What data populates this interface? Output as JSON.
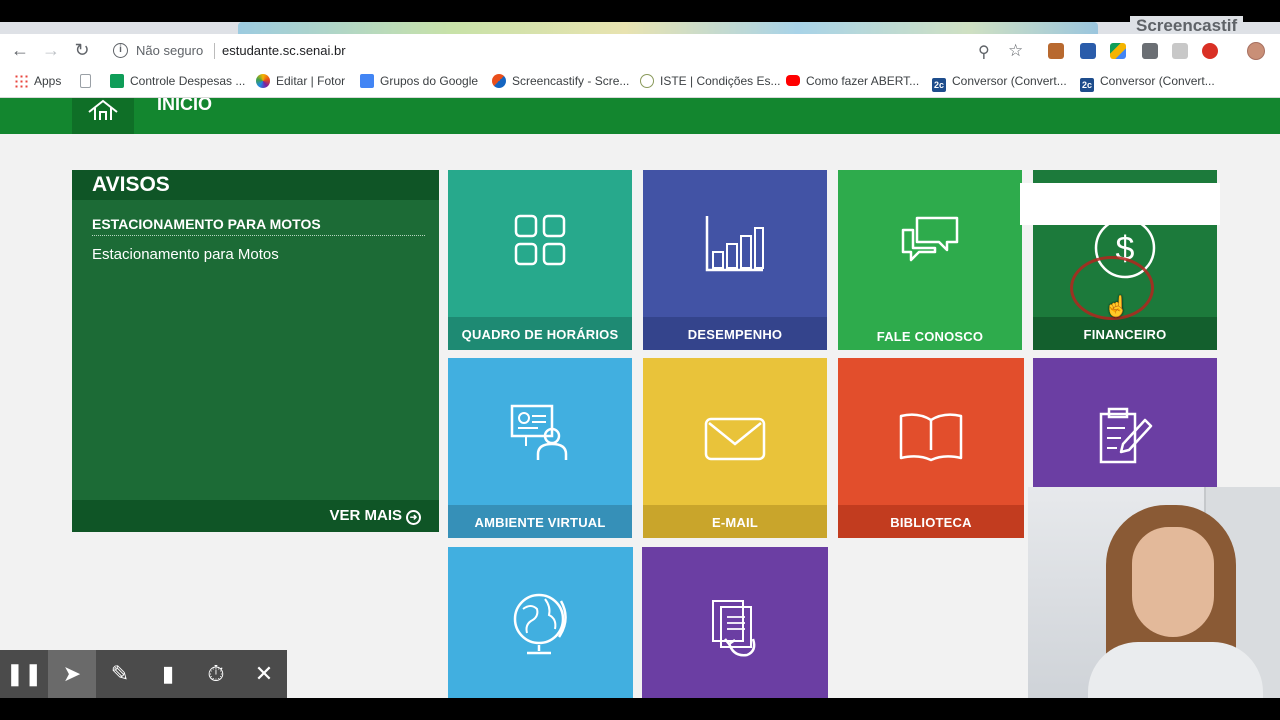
{
  "browser": {
    "brand_text": "Screencastif",
    "security_label": "Não seguro",
    "url": "estudante.sc.senai.br",
    "bookmarks": [
      {
        "label": "Apps",
        "icon": "apps-grid-icon",
        "color": "#e8453c"
      },
      {
        "label": "",
        "icon": "page-icon",
        "color": "#9aa0a6"
      },
      {
        "label": "Controle Despesas ...",
        "icon": "sheets-icon",
        "color": "#0f9d58"
      },
      {
        "label": "Editar | Fotor",
        "icon": "fotor-icon",
        "color": "#f4b400"
      },
      {
        "label": "Grupos do Google",
        "icon": "groups-icon",
        "color": "#4285f4"
      },
      {
        "label": "Screencastify - Scre...",
        "icon": "screencastify-icon",
        "color": "#e94e1b"
      },
      {
        "label": "ISTE | Condições Es...",
        "icon": "iste-icon",
        "color": "#8a9a5b"
      },
      {
        "label": "Como fazer ABERT...",
        "icon": "youtube-icon",
        "color": "#ff0000"
      },
      {
        "label": "Conversor (Convert...",
        "icon": "converter-icon",
        "color": "#1e4d8c"
      },
      {
        "label": "Conversor (Convert...",
        "icon": "converter-icon",
        "color": "#1e4d8c"
      }
    ]
  },
  "page": {
    "section_title": "INICIO",
    "avisos": {
      "title": "AVISOS",
      "notice_title": "ESTACIONAMENTO PARA MOTOS",
      "notice_body": "Estacionamento para Motos",
      "more_label": "VER MAIS"
    },
    "tiles": [
      {
        "label": "QUADRO DE HORÁRIOS",
        "icon": "grid-icon",
        "color": "#27a98c",
        "bar": "#1e8a73"
      },
      {
        "label": "DESEMPENHO",
        "icon": "bar-chart-icon",
        "color": "#4253a5",
        "bar": "#34448c"
      },
      {
        "label": "FALE CONOSCO",
        "icon": "chat-bubbles-icon",
        "color": "#2eab4c",
        "bar": "#2eab4c"
      },
      {
        "label": "FINANCEIRO",
        "icon": "dollar-icon",
        "color": "#1c7a3b",
        "bar": "#135f2d"
      },
      {
        "label": "AMBIENTE VIRTUAL",
        "icon": "virtual-class-icon",
        "color": "#41afe0",
        "bar": "#3690b8"
      },
      {
        "label": "E-MAIL",
        "icon": "envelope-icon",
        "color": "#e9c33a",
        "bar": "#c9a52b"
      },
      {
        "label": "BIBLIOTECA",
        "icon": "book-icon",
        "color": "#e24e2c",
        "bar": "#c23c1f"
      },
      {
        "label": "",
        "icon": "clipboard-edit-icon",
        "color": "#6b3ea3",
        "bar": "#6b3ea3"
      },
      {
        "label": "",
        "icon": "globe-icon",
        "color": "#41afe0",
        "bar": "#41afe0"
      },
      {
        "label": "",
        "icon": "documents-icon",
        "color": "#6b3ea3",
        "bar": "#6b3ea3"
      }
    ]
  },
  "recorder": {
    "tools": [
      "pause-icon",
      "pointer-icon",
      "pen-icon",
      "eraser-icon",
      "timer-icon",
      "close-icon"
    ]
  }
}
